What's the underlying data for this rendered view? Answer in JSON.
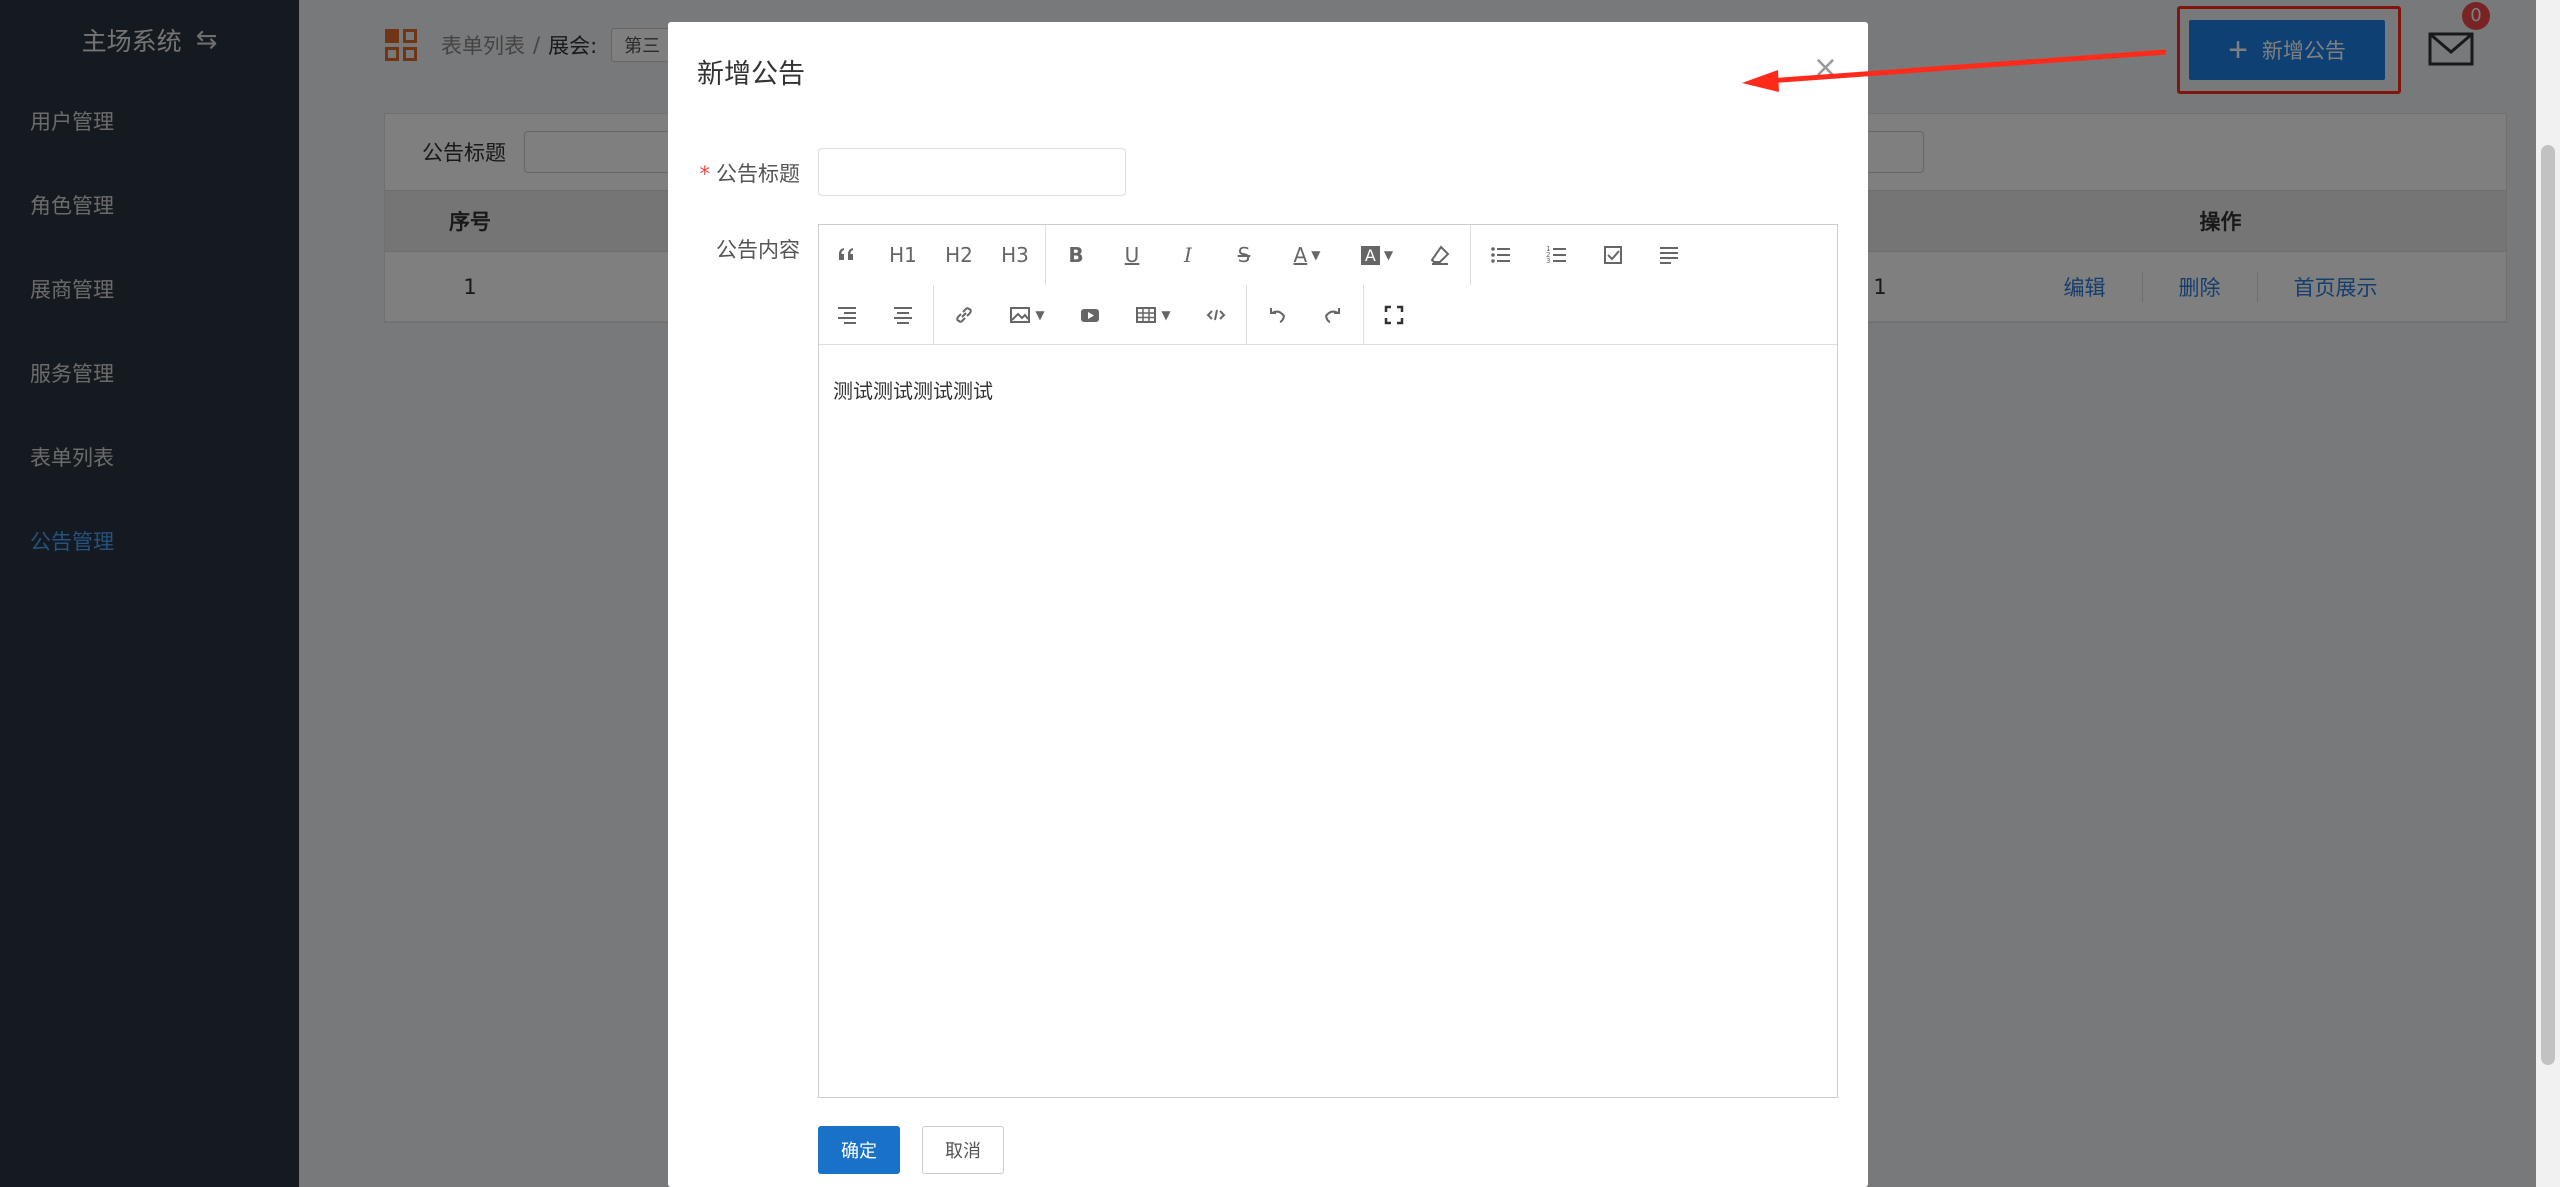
{
  "sidebar": {
    "title": "主场系统",
    "switch_icon": "⇆",
    "items": [
      {
        "label": "用户管理"
      },
      {
        "label": "角色管理"
      },
      {
        "label": "展商管理"
      },
      {
        "label": "服务管理"
      },
      {
        "label": "表单列表"
      },
      {
        "label": "公告管理"
      }
    ],
    "active_index": 5
  },
  "header": {
    "breadcrumb_root": "表单列表",
    "breadcrumb_sep": "/",
    "breadcrumb_label": "展会:",
    "breadcrumb_select": "第三",
    "add_button_label": "新增公告",
    "mail_badge": "0"
  },
  "list": {
    "filter_label": "公告标题",
    "columns": [
      "序号",
      "操作"
    ],
    "rows": [
      {
        "index": "1",
        "extra": "1",
        "ops": [
          "编辑",
          "删除",
          "首页展示"
        ]
      }
    ]
  },
  "modal": {
    "title": "新增公告",
    "close": "×",
    "title_field_label": "公告标题",
    "title_field_required": "*",
    "title_field_value": "",
    "content_label": "公告内容",
    "content_text": "测试测试测试测试",
    "toolbar_text": {
      "h1": "H1",
      "h2": "H2",
      "h3": "H3",
      "bold": "B",
      "underline": "U",
      "italic": "I",
      "strike": "S",
      "font_color": "A",
      "bg_color": "A"
    },
    "ok_label": "确定",
    "cancel_label": "取消"
  },
  "colors": {
    "sidebar_bg": "#2b3543",
    "active_menu": "#4aa3ff",
    "primary": "#1f80e6",
    "annotation": "#ff2a1a"
  }
}
